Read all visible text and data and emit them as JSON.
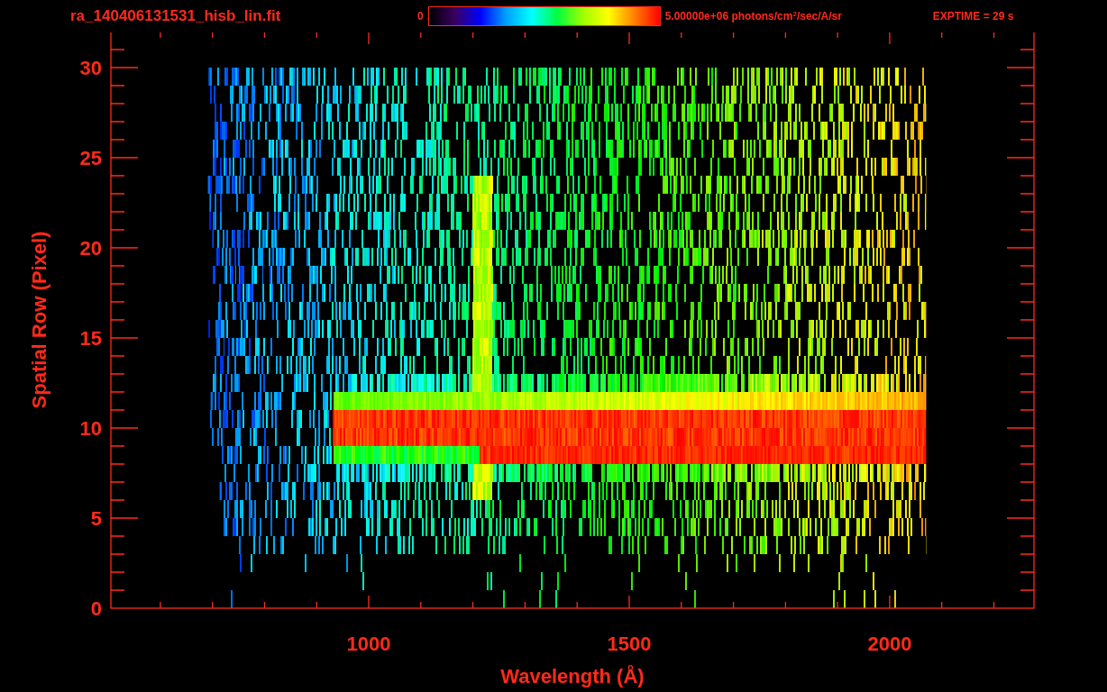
{
  "header": {
    "filename": "ra_140406131531_hisb_lin.fit",
    "colorbar": {
      "min_label": "0",
      "max_label": "5.00000e+06 photons/cm$^{2}$/sec/A/sr"
    },
    "exposure": "EXPTIME = 29 s"
  },
  "plot": {
    "ylabel": "Spatial Row (Pixel)",
    "xlabel": "Wavelength (Å)",
    "xtick_labels": [
      "1000",
      "1500",
      "2000"
    ],
    "ytick_labels": [
      "30",
      "25",
      "20",
      "15",
      "10",
      "5",
      "0"
    ]
  }
}
